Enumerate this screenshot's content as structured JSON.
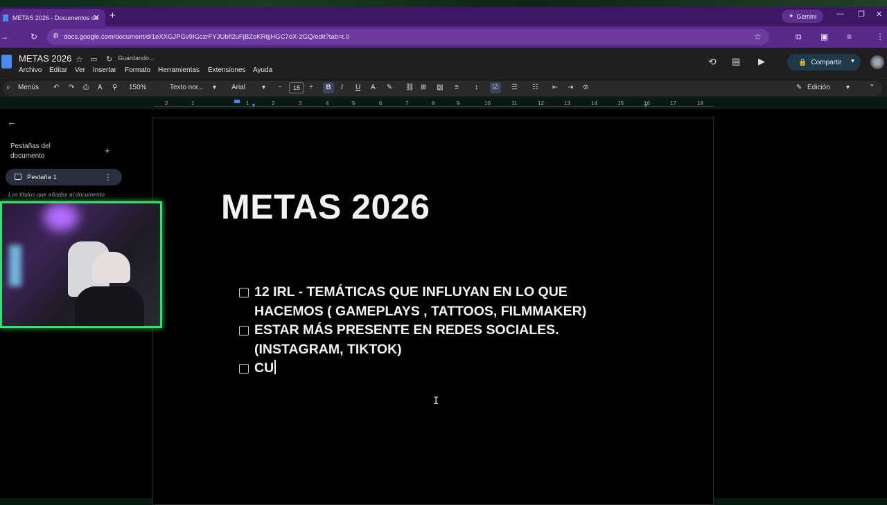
{
  "browser": {
    "tab_title": "METAS 2026 - Documentos de",
    "new_tab_glyph": "+",
    "gemini_label": "Gemini",
    "url": "docs.google.com/document/d/1eXXGJPGv9IGczrFYJUbfl2uFjBZoKRtjjHGC7oX-2GQ/edit?tab=t.0"
  },
  "docs": {
    "title": "METAS 2026",
    "save_status": "Guardando...",
    "menus": [
      "Archivo",
      "Editar",
      "Ver",
      "Insertar",
      "Formato",
      "Herramientas",
      "Extensiones",
      "Ayuda"
    ],
    "share_label": "Compartir"
  },
  "toolbar": {
    "search_label": "Menús",
    "zoom": "150%",
    "style": "Texto nor...",
    "font": "Arial",
    "font_size": "15",
    "mode_label": "Edición"
  },
  "ruler": [
    "2",
    "1",
    "1",
    "2",
    "3",
    "4",
    "5",
    "6",
    "7",
    "8",
    "9",
    "10",
    "11",
    "12",
    "13",
    "14",
    "15",
    "16",
    "17",
    "18"
  ],
  "sidebar": {
    "title": "Pestañas del documento",
    "tab_label": "Pestaña 1",
    "hint": "Los títulos que añadas al documento"
  },
  "document": {
    "heading": "METAS 2026",
    "items": [
      {
        "line1": "12 IRL - TEMÁTICAS QUE INFLUYAN EN LO QUE",
        "line2": "HACEMOS ( GAMEPLAYS , TATTOOS, FILMMAKER)"
      },
      {
        "line1": "ESTAR MÁS PRESENTE EN REDES SOCIALES.",
        "line2": "(INSTAGRAM, TIKTOK)"
      },
      {
        "line1": "CU",
        "line2": ""
      }
    ]
  },
  "colors": {
    "tab_bar": "#3c1763",
    "address_bar": "#5a2a8a",
    "webcam_border": "#28e86c",
    "page_bg": "#000000"
  }
}
